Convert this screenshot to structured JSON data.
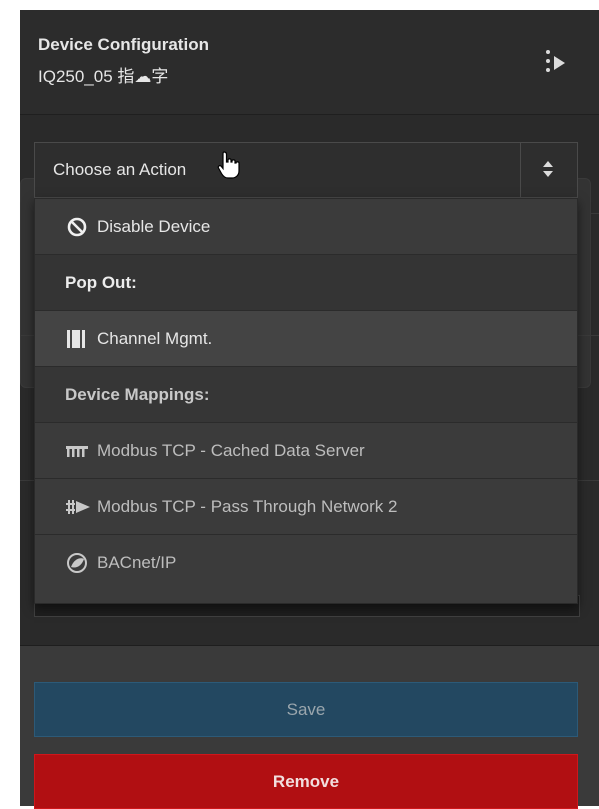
{
  "header": {
    "title": "Device Configuration",
    "subtitle": "IQ250_05 指☁字"
  },
  "action_select": {
    "value": "Choose an Action"
  },
  "dropdown": {
    "items": [
      {
        "type": "item",
        "label": "Disable Device",
        "icon": "ban-icon"
      },
      {
        "type": "header",
        "label": "Pop Out:"
      },
      {
        "type": "item",
        "label": "Channel Mgmt.",
        "icon": "channels-icon"
      },
      {
        "type": "header",
        "label": "Device Mappings:"
      },
      {
        "type": "item",
        "label": "Modbus TCP - Cached Data Server",
        "icon": "cached-server-icon"
      },
      {
        "type": "item",
        "label": "Modbus TCP - Pass Through Network 2",
        "icon": "pass-through-icon"
      },
      {
        "type": "item",
        "label": "BACnet/IP",
        "icon": "bacnet-icon"
      }
    ]
  },
  "footer": {
    "save_label": "Save",
    "remove_label": "Remove"
  },
  "colors": {
    "panel": "#2b2b2b",
    "save": "#234861",
    "remove": "#b10f12"
  }
}
